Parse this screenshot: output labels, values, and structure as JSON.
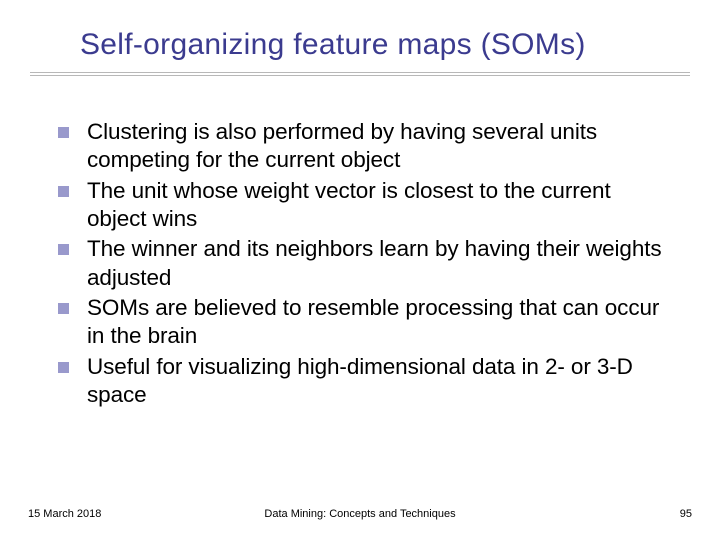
{
  "title": "Self-organizing feature maps (SOMs)",
  "bullets": [
    "Clustering is also performed by having several units competing for the current object",
    "The unit whose weight vector is closest to the current object wins",
    "The winner and its neighbors learn by having their weights adjusted",
    "SOMs are believed to resemble processing that can occur in the brain",
    "Useful for visualizing high-dimensional data in 2- or 3-D space"
  ],
  "footer": {
    "date": "15 March 2018",
    "center": "Data Mining: Concepts and Techniques",
    "page": "95"
  }
}
